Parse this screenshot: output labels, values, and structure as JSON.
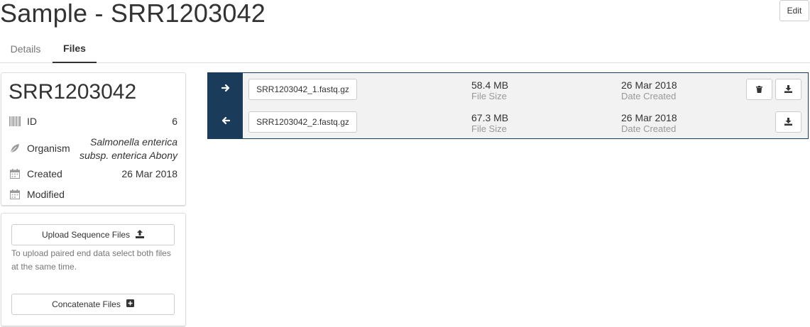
{
  "header": {
    "title": "Sample - SRR1203042",
    "edit_label": "Edit"
  },
  "tabs": [
    {
      "label": "Details",
      "active": false
    },
    {
      "label": "Files",
      "active": true
    }
  ],
  "sample": {
    "name": "SRR1203042",
    "props": {
      "id": {
        "label": "ID",
        "value": "6",
        "icon": "barcode-icon"
      },
      "organism": {
        "label": "Organism",
        "value_line1": "Salmonella enterica",
        "value_line2": "subsp. enterica Abony",
        "icon": "leaf-icon"
      },
      "created": {
        "label": "Created",
        "value": "26 Mar 2018",
        "icon": "calendar-icon"
      },
      "modified": {
        "label": "Modified",
        "value": "",
        "icon": "calendar-icon"
      }
    }
  },
  "upload": {
    "upload_label": "Upload Sequence Files",
    "help_text": "To upload paired end data select both files at the same time.",
    "concat_label": "Concatenate Files"
  },
  "files": [
    {
      "direction": "forward",
      "name": "SRR1203042_1.fastq.gz",
      "size": "58.4 MB",
      "size_label": "File Size",
      "date": "26 Mar 2018",
      "date_label": "Date Created"
    },
    {
      "direction": "reverse",
      "name": "SRR1203042_2.fastq.gz",
      "size": "67.3 MB",
      "size_label": "File Size",
      "date": "26 Mar 2018",
      "date_label": "Date Created"
    }
  ],
  "colors": {
    "accent": "#1b3b5a",
    "row_bg": "#f2f2f2"
  }
}
